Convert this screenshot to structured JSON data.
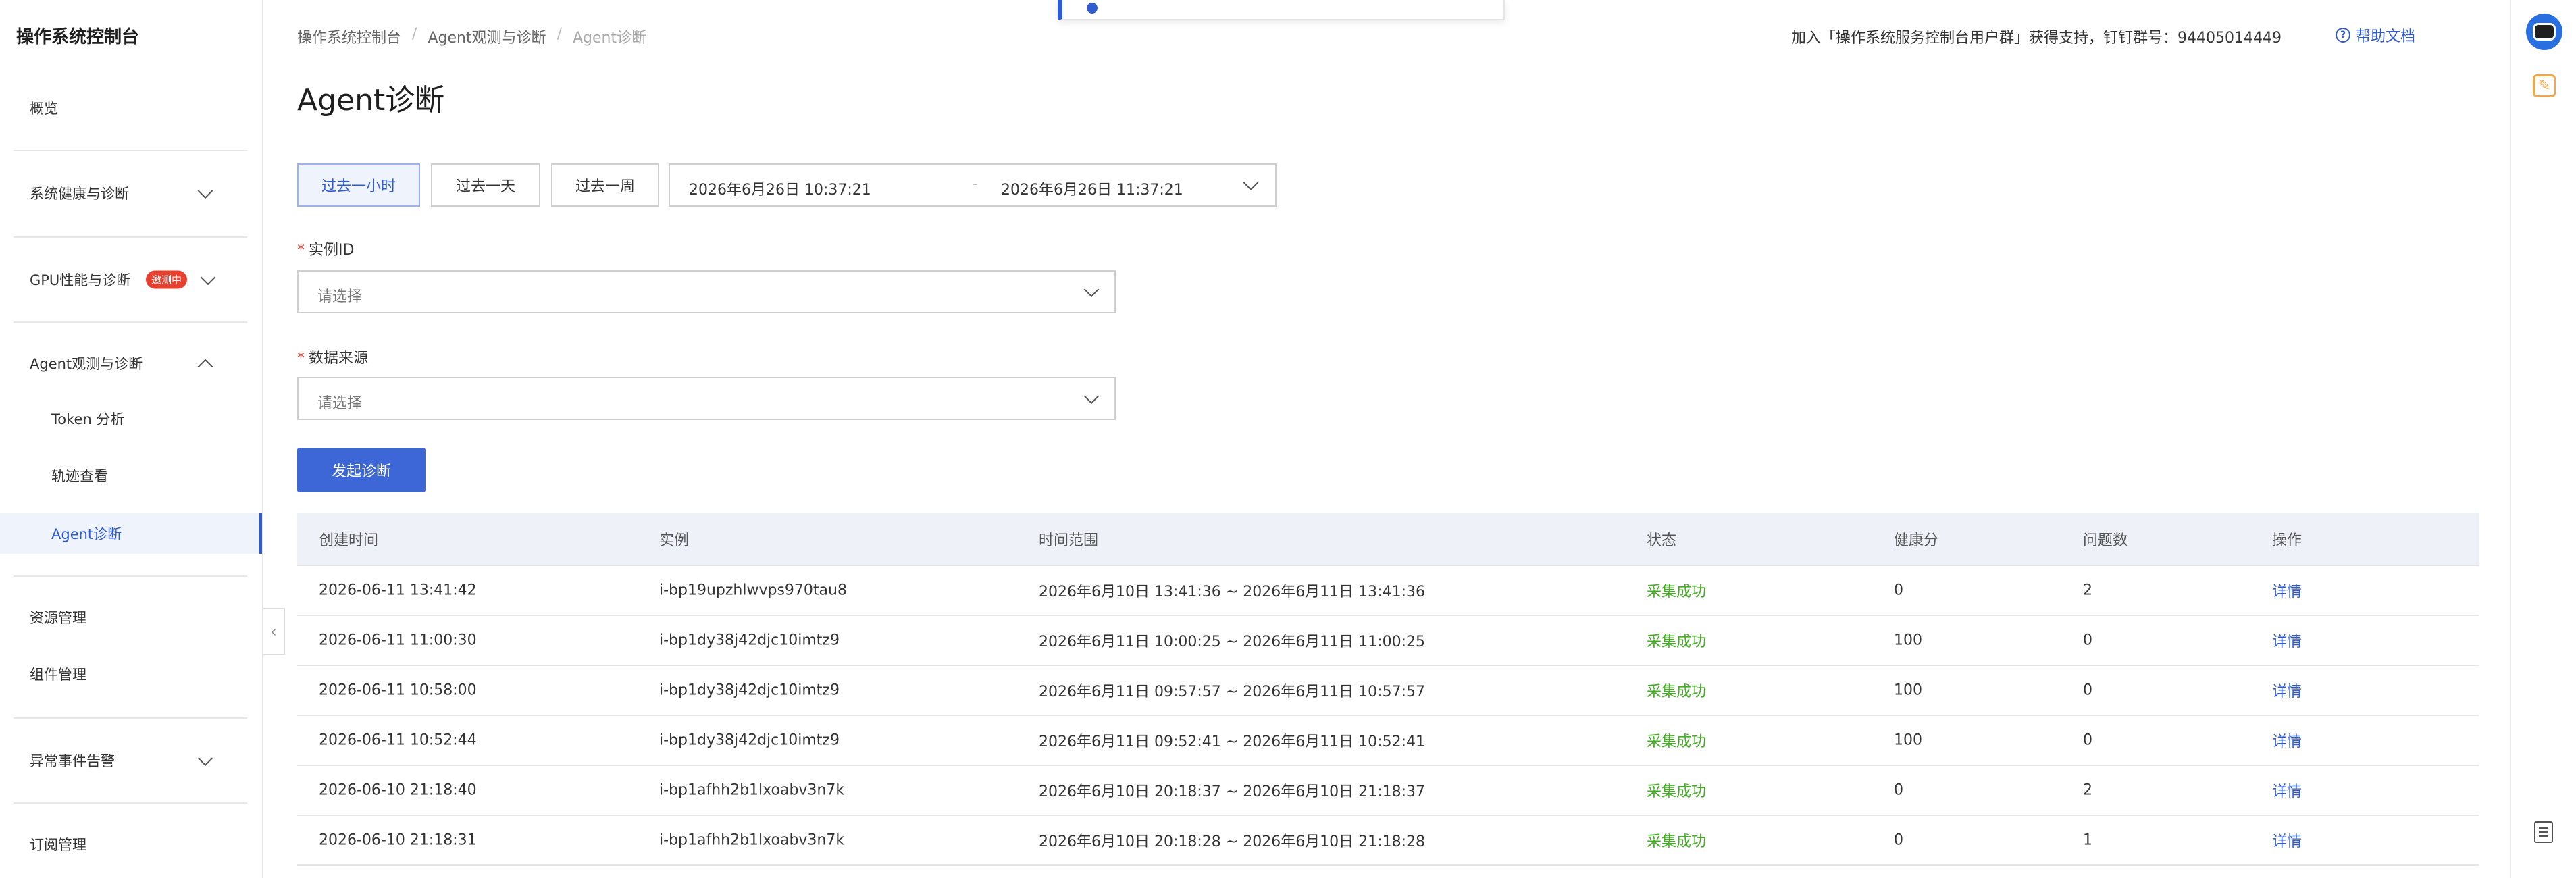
{
  "app": {
    "title": "操作系统控制台"
  },
  "sidebar": {
    "items": [
      {
        "label": "概览"
      },
      {
        "label": "系统健康与诊断"
      },
      {
        "label": "GPU性能与诊断",
        "badge": "邀测中"
      },
      {
        "label": "Agent观测与诊断"
      },
      {
        "label": "Token 分析"
      },
      {
        "label": "轨迹查看"
      },
      {
        "label": "Agent诊断"
      },
      {
        "label": "资源管理"
      },
      {
        "label": "组件管理"
      },
      {
        "label": "异常事件告警"
      },
      {
        "label": "订阅管理"
      }
    ]
  },
  "breadcrumb": [
    "操作系统控制台",
    "Agent观测与诊断",
    "Agent诊断"
  ],
  "header": {
    "notice": "加入「操作系统服务控制台用户群」获得支持，钉钉群号：94405014449",
    "help": "帮助文档"
  },
  "page": {
    "title": "Agent诊断"
  },
  "time_buttons": [
    "过去一小时",
    "过去一天",
    "过去一周"
  ],
  "range": {
    "start": "2026年6月26日 10:37:21",
    "sep": "-",
    "end": "2026年6月26日 11:37:21"
  },
  "form": {
    "instance": {
      "label": "实例ID",
      "placeholder": "请选择"
    },
    "source": {
      "label": "数据来源",
      "placeholder": "请选择"
    },
    "submit": "发起诊断"
  },
  "table": {
    "headers": [
      "创建时间",
      "实例",
      "时间范围",
      "状态",
      "健康分",
      "问题数",
      "操作"
    ],
    "rows": [
      [
        "2026-06-11 13:41:42",
        "i-bp19upzhlwvps970tau8",
        "2026年6月10日 13:41:36 ~ 2026年6月11日 13:41:36",
        "采集成功",
        "0",
        "2",
        "详情"
      ],
      [
        "2026-06-11 11:00:30",
        "i-bp1dy38j42djc10imtz9",
        "2026年6月11日 10:00:25 ~ 2026年6月11日 11:00:25",
        "采集成功",
        "100",
        "0",
        "详情"
      ],
      [
        "2026-06-11 10:58:00",
        "i-bp1dy38j42djc10imtz9",
        "2026年6月11日 09:57:57 ~ 2026年6月11日 10:57:57",
        "采集成功",
        "100",
        "0",
        "详情"
      ],
      [
        "2026-06-11 10:52:44",
        "i-bp1dy38j42djc10imtz9",
        "2026年6月11日 09:52:41 ~ 2026年6月11日 10:52:41",
        "采集成功",
        "100",
        "0",
        "详情"
      ],
      [
        "2026-06-10 21:18:40",
        "i-bp1afhh2b1lxoabv3n7k",
        "2026年6月10日 20:18:37 ~ 2026年6月10日 21:18:37",
        "采集成功",
        "0",
        "2",
        "详情"
      ],
      [
        "2026-06-10 21:18:31",
        "i-bp1afhh2b1lxoabv3n7k",
        "2026年6月10日 20:18:28 ~ 2026年6月10日 21:18:28",
        "采集成功",
        "0",
        "1",
        "详情"
      ]
    ]
  },
  "colors": {
    "accent": "#2f5bd1",
    "success": "#41b01f",
    "badge": "#e8402f",
    "primary_button": "#3d66d6"
  }
}
